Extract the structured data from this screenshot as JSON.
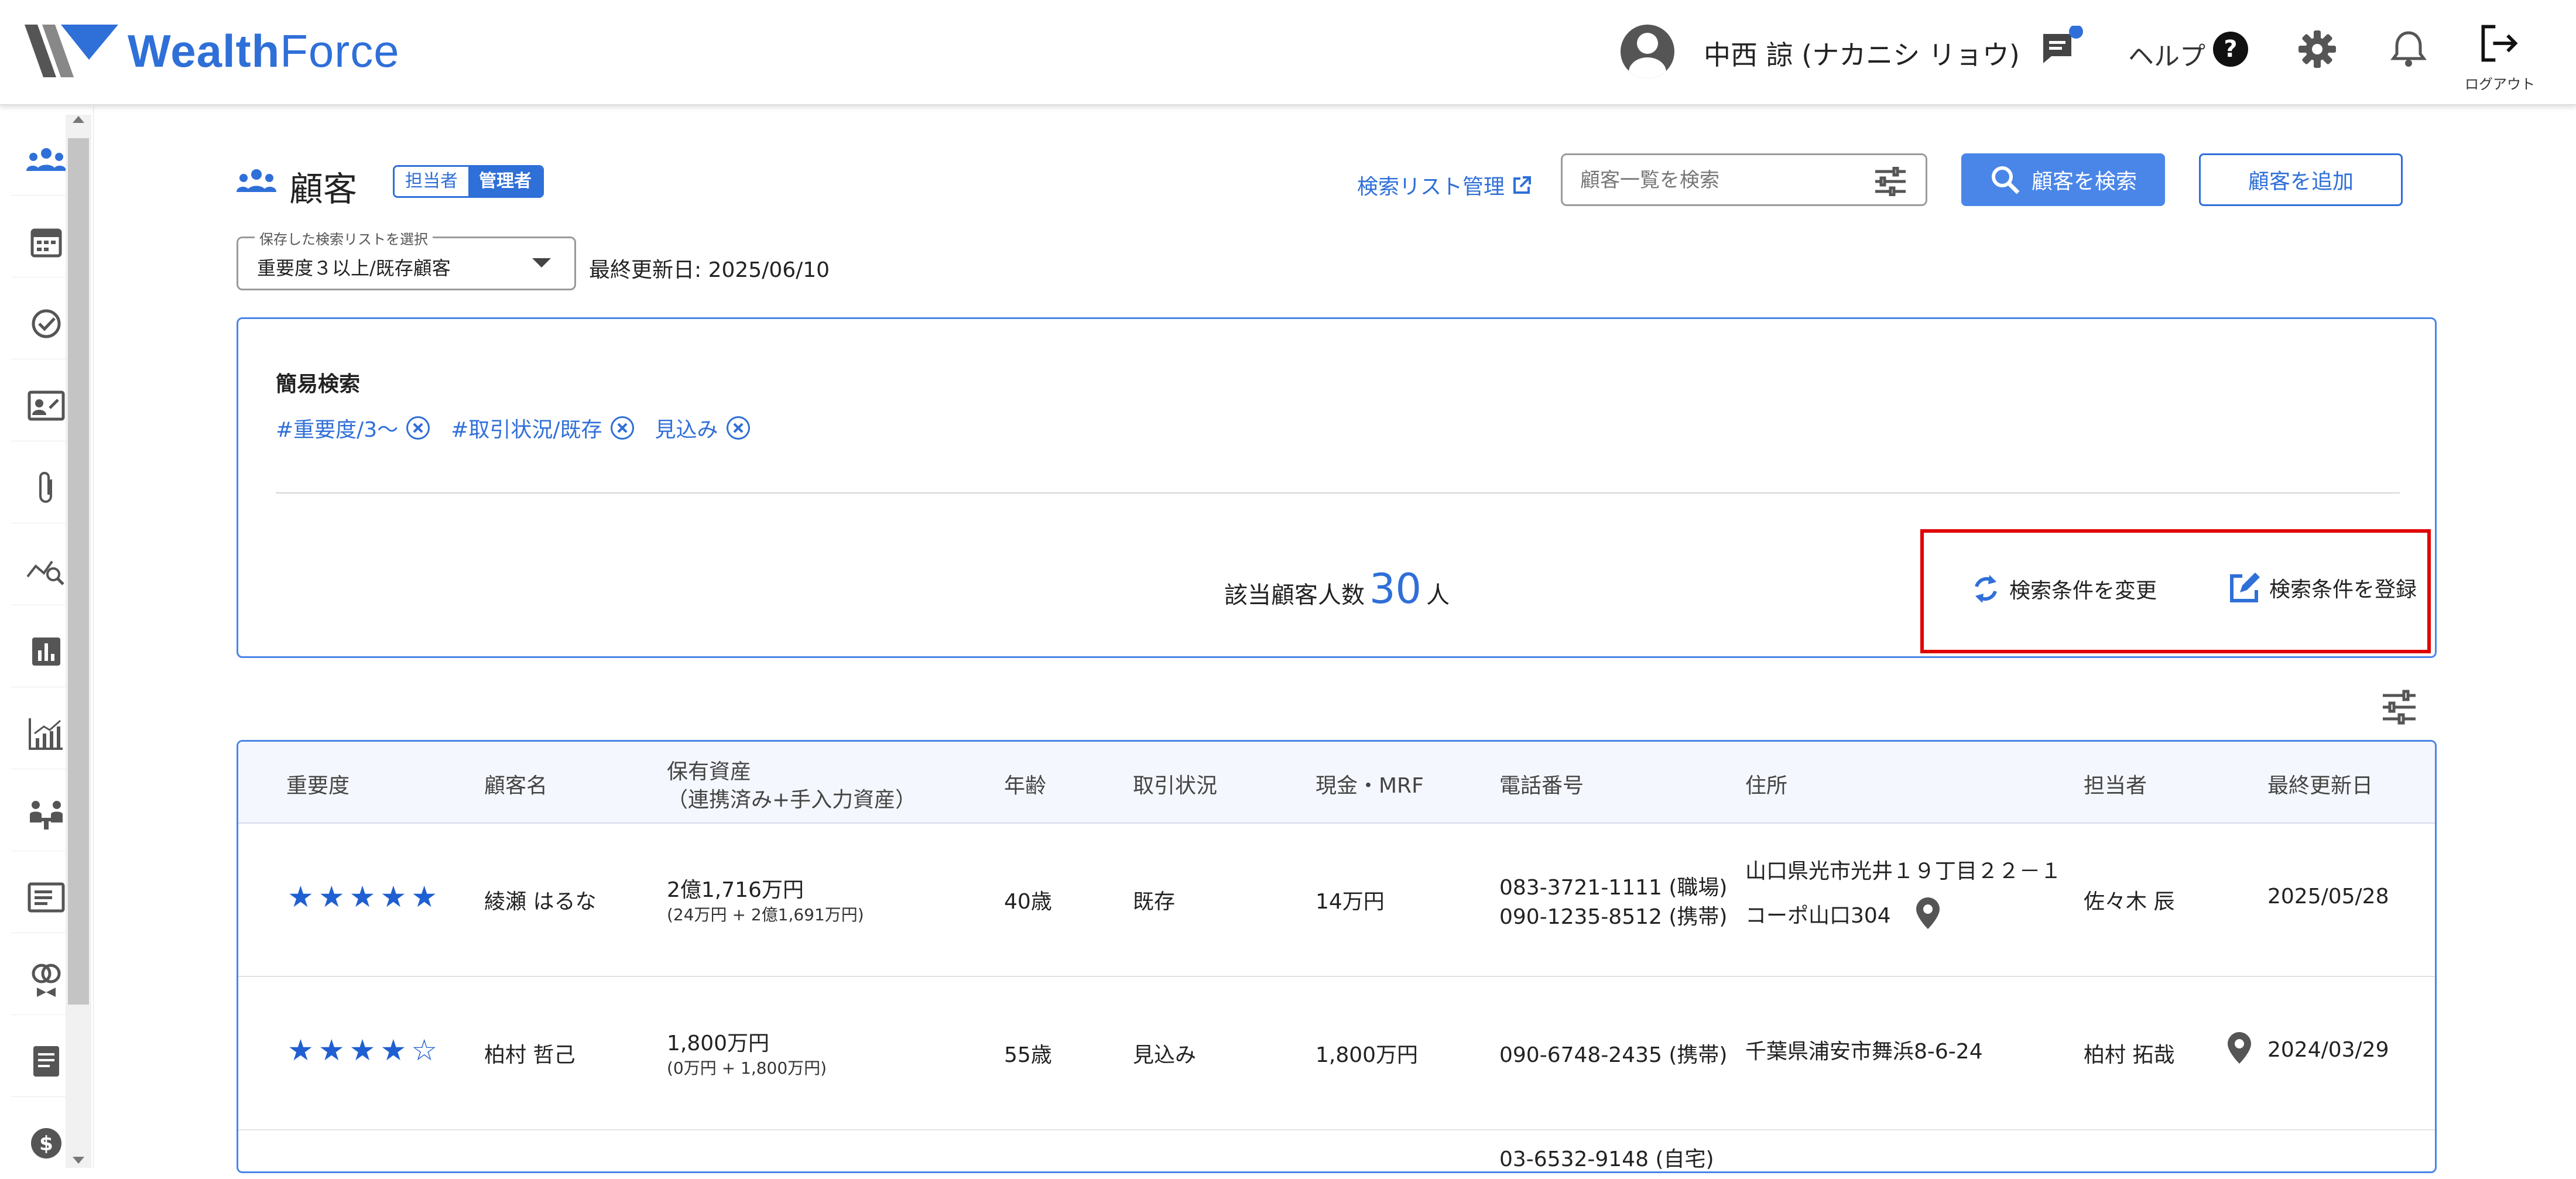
{
  "header": {
    "logo_text_a": "Wealth",
    "logo_text_b": "Force",
    "user_name": "中西 諒 (ナカニシ リョウ)",
    "help_label": "ヘルプ",
    "logout_label": "ログアウト",
    "accent_color": "#2f6fd8"
  },
  "sidebar": {
    "items": [
      {
        "icon": "people-icon",
        "active": true
      },
      {
        "icon": "calendar-icon"
      },
      {
        "icon": "check-circle-icon"
      },
      {
        "icon": "contact-card-icon"
      },
      {
        "icon": "paperclip-icon"
      },
      {
        "icon": "chart-search-icon"
      },
      {
        "icon": "bar-chart-icon"
      },
      {
        "icon": "growth-chart-icon"
      },
      {
        "icon": "meeting-icon"
      },
      {
        "icon": "document-icon"
      },
      {
        "icon": "rings-icon"
      },
      {
        "icon": "notes-icon"
      },
      {
        "icon": "dollar-icon"
      }
    ]
  },
  "page": {
    "title": "顧客",
    "role_assignee": "担当者",
    "role_admin": "管理者",
    "search_list_link": "検索リスト管理",
    "search_placeholder": "顧客一覧を検索",
    "search_button": "顧客を検索",
    "add_button": "顧客を追加",
    "saved_list_legend": "保存した検索リストを選択",
    "saved_list_value": "重要度３以上/既存顧客",
    "last_updated": "最終更新日: 2025/06/10"
  },
  "filter": {
    "title": "簡易検索",
    "chips": [
      "#重要度/3〜",
      "#取引状況/既存",
      "見込み"
    ],
    "count_label": "該当顧客人数",
    "count": "30",
    "count_unit": "人",
    "change_label": "検索条件を変更",
    "register_label": "検索条件を登録",
    "highlight_color": "#e00000"
  },
  "table": {
    "headers": {
      "importance": "重要度",
      "name": "顧客名",
      "assets_line1": "保有資産",
      "assets_line2": "（連携済み+手入力資産）",
      "age": "年齢",
      "status": "取引状況",
      "cash": "現金・MRF",
      "phone": "電話番号",
      "address": "住所",
      "owner": "担当者",
      "updated": "最終更新日"
    },
    "rows": [
      {
        "stars": "★★★★★",
        "rating": 5,
        "name": "綾瀬 はるな",
        "assets": "2億1,716万円",
        "assets_detail": "(24万円 + 2億1,691万円)",
        "age": "40歳",
        "status": "既存",
        "cash": "14万円",
        "phone1": "083-3721-1111 (職場)",
        "phone2": "090-1235-8512 (携帯)",
        "address1": "山口県光市光井１９丁目２２－１",
        "address2": "コーポ山口304",
        "owner": "佐々木 辰",
        "updated": "2025/05/28"
      },
      {
        "stars": "★★★★☆",
        "rating": 4,
        "name": "柏村 哲己",
        "assets": "1,800万円",
        "assets_detail": "(0万円 + 1,800万円)",
        "age": "55歳",
        "status": "見込み",
        "cash": "1,800万円",
        "phone1": "090-6748-2435 (携帯)",
        "address1": "千葉県浦安市舞浜8-6-24",
        "owner": "柏村 拓哉",
        "updated": "2024/03/29"
      },
      {
        "phone1": "03-6532-9148 (自宅)"
      }
    ]
  }
}
